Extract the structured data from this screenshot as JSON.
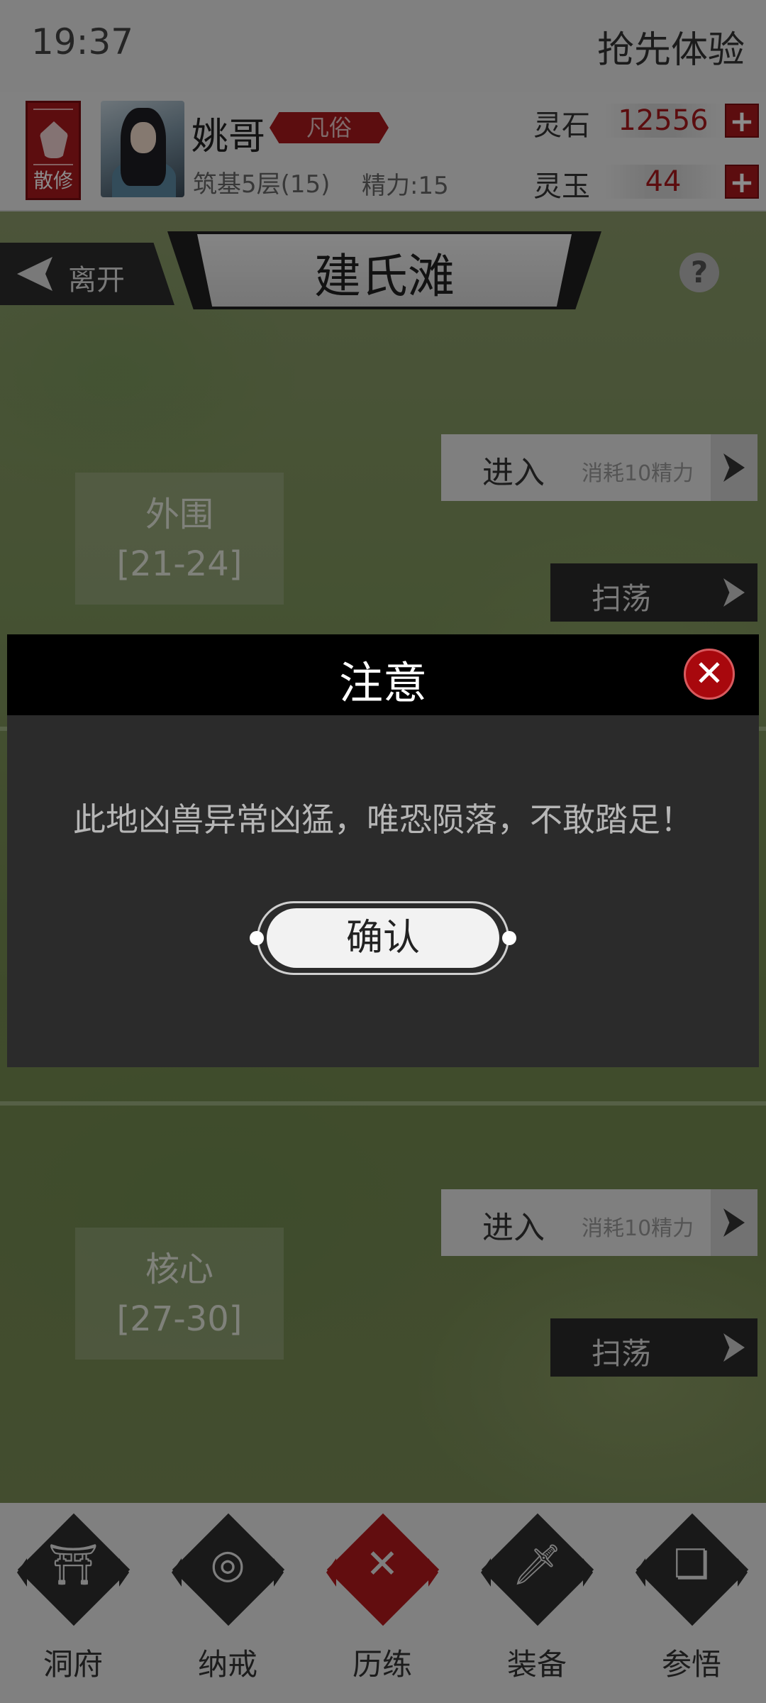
{
  "status_bar": {
    "time": "19:37",
    "early_access": "抢先体验"
  },
  "player": {
    "sect": "散修",
    "name": "姚哥",
    "rank": "凡俗",
    "realm": "筑基5层(15)",
    "energy": "精力:15",
    "resources": [
      {
        "label": "灵石",
        "value": "12556"
      },
      {
        "label": "灵玉",
        "value": "44"
      }
    ]
  },
  "area": {
    "leave": "离开",
    "title": "建氏滩",
    "help": "?"
  },
  "zones": [
    {
      "name": "外围",
      "levels": "[21-24]",
      "enter": "进入",
      "cost": "消耗10精力",
      "sweep": "扫荡"
    },
    {
      "name": "核心",
      "levels": "[27-30]",
      "enter": "进入",
      "cost": "消耗10精力",
      "sweep": "扫荡"
    }
  ],
  "dialog": {
    "title": "注意",
    "close": "✕",
    "message": "此地凶兽异常凶猛，唯恐陨落，不敢踏足！",
    "confirm": "确认"
  },
  "bottom_nav": [
    {
      "label": "洞府",
      "icon": "gate-icon",
      "glyph": "⛩"
    },
    {
      "label": "纳戒",
      "icon": "ring-icon",
      "glyph": "◎"
    },
    {
      "label": "历练",
      "icon": "crossed-swords-icon",
      "glyph": "✕",
      "active": true
    },
    {
      "label": "装备",
      "icon": "dagger-icon",
      "glyph": "🗡"
    },
    {
      "label": "参悟",
      "icon": "book-icon",
      "glyph": "❏"
    }
  ],
  "colors": {
    "accent": "#a8181c",
    "dialog_header": "#000000",
    "dialog_body": "#2b2b2b"
  }
}
